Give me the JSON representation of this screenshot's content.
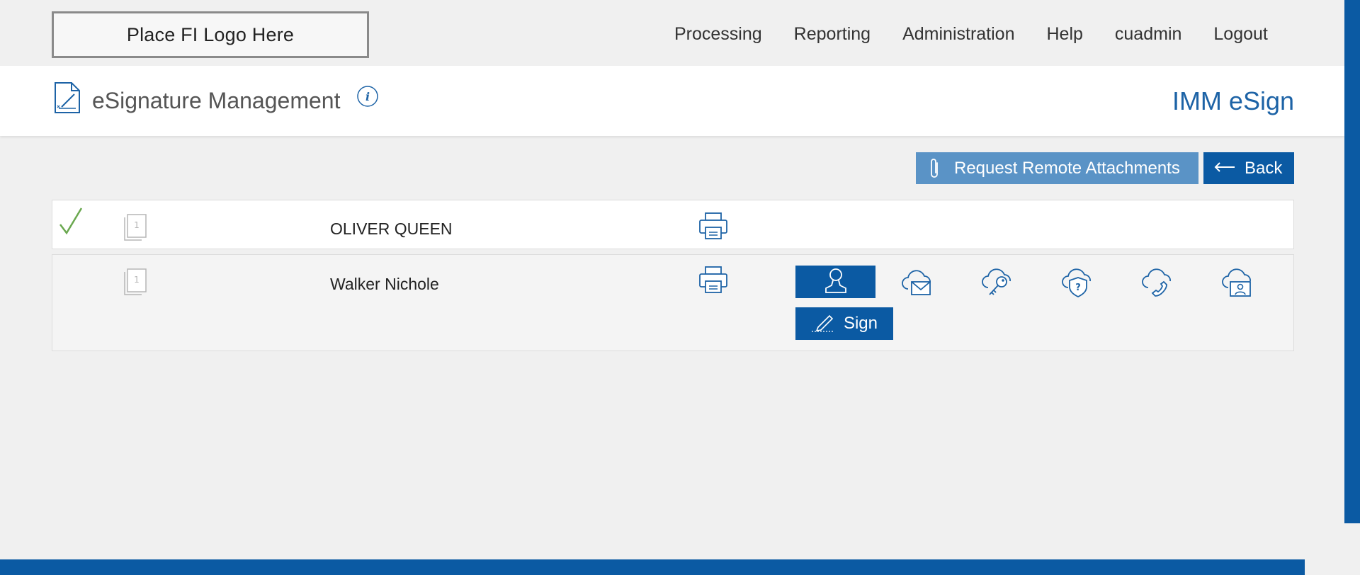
{
  "header": {
    "logo_text": "Place FI Logo Here",
    "nav": [
      "Processing",
      "Reporting",
      "Administration",
      "Help",
      "cuadmin",
      "Logout"
    ]
  },
  "title_band": {
    "page_title": "eSignature Management",
    "brand": "IMM eSign"
  },
  "actions": {
    "request_remote_label": "Request Remote Attachments",
    "back_label": "Back"
  },
  "signers": [
    {
      "name": "OLIVER QUEEN",
      "page_count": "1",
      "completed": true
    },
    {
      "name": "Walker Nichole",
      "page_count": "1",
      "completed": false,
      "auth_methods": [
        "in-person-icon",
        "email-cloud-icon",
        "key-cloud-icon",
        "security-question-cloud-icon",
        "phone-cloud-icon",
        "id-cloud-icon"
      ],
      "sign_label": "Sign"
    }
  ],
  "colors": {
    "primary": "#0b5aa3",
    "secondary_button": "#5a93c6",
    "brand_text": "#1d63a6",
    "check": "#6aa84f",
    "icon_grey": "#b5b5b5"
  }
}
